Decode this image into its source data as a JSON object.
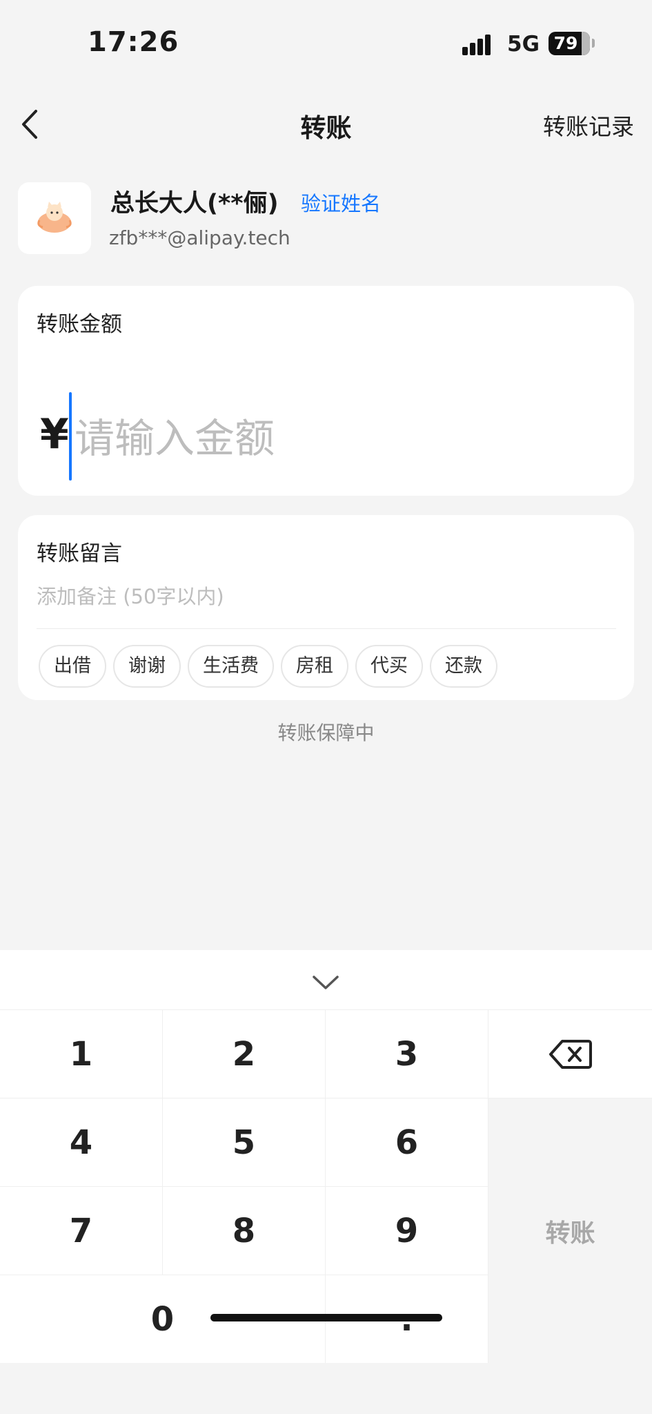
{
  "status_bar": {
    "time": "17:26",
    "network": "5G",
    "battery": "79"
  },
  "nav": {
    "title": "转账",
    "right_action": "转账记录"
  },
  "payee": {
    "name": "总长大人(**俪)",
    "verify_label": "验证姓名",
    "account": "zfb***@alipay.tech"
  },
  "amount": {
    "label": "转账金额",
    "currency": "¥",
    "placeholder": "请输入金额",
    "value": ""
  },
  "memo": {
    "label": "转账留言",
    "placeholder": "添加备注 (50字以内)",
    "chips": [
      "出借",
      "谢谢",
      "生活费",
      "房租",
      "代买",
      "还款"
    ]
  },
  "guarantee": "转账保障中",
  "keyboard": {
    "keys": [
      "1",
      "2",
      "3",
      "4",
      "5",
      "6",
      "7",
      "8",
      "9",
      "0",
      "."
    ],
    "submit_label": "转账"
  },
  "icons": {
    "back": "chevron-left-icon",
    "collapse": "chevron-down-icon",
    "delete": "backspace-icon",
    "avatar": "cat-avatar-icon"
  }
}
